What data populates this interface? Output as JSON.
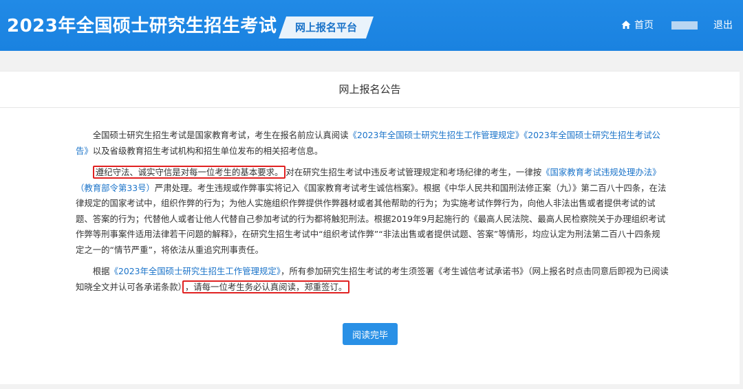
{
  "header": {
    "site_title": "2023年全国硕士研究生招生考试",
    "platform_label": "网上报名平台",
    "home_label": "首页",
    "logout_label": "退出",
    "accent_color": "#1e88e5"
  },
  "notice": {
    "title": "网上报名公告",
    "p1": {
      "t1": "全国硕士研究生招生考试是国家教育考试，考生在报名前应认真阅读",
      "l1": "《2023年全国硕士研究生招生工作管理规定》",
      "l2": "《2023年全国硕士研究生招生考试公告》",
      "t2": "以及省级教育招生考试机构和招生单位发布的相关招考信息。"
    },
    "p2": {
      "hl": "遵纪守法、诚实守信是对每一位考生的基本要求。",
      "t1": "对在研究生招生考试中违反考试管理规定和考场纪律的考生，一律按",
      "l1": "《国家教育考试违规处理办法》（教育部令第33号）",
      "t2": "严肃处理。考生违规或作弊事实将记入《国家教育考试考生诚信档案》。根据《中华人民共和国刑法修正案（九）》第二百八十四条，在法律规定的国家考试中，组织作弊的行为；为他人实施组织作弊提供作弊器材或者其他帮助的行为；为实施考试作弊行为，向他人非法出售或者提供考试的试题、答案的行为；代替他人或者让他人代替自己参加考试的行为都将触犯刑法。根据2019年9月起施行的《最高人民法院、最高人民检察院关于办理组织考试作弊等刑事案件适用法律若干问题的解释》，在研究生招生考试中“组织考试作弊”“非法出售或者提供试题、答案”等情形，均应认定为刑法第二百八十四条规定之一的“情节严重”，将依法从重追究刑事责任。"
    },
    "p3": {
      "t1": "根据",
      "l1": "《2023年全国硕士研究生招生工作管理规定》",
      "t2": "，所有参加研究生招生考试的考生须签署《考生诚信考试承诺书》（网上报名时点击同意后即视为已阅读知晓全文并认可各承诺条款）",
      "hl": "，请每一位考生务必认真阅读，郑重签订。"
    },
    "button_label": "阅读完毕"
  }
}
